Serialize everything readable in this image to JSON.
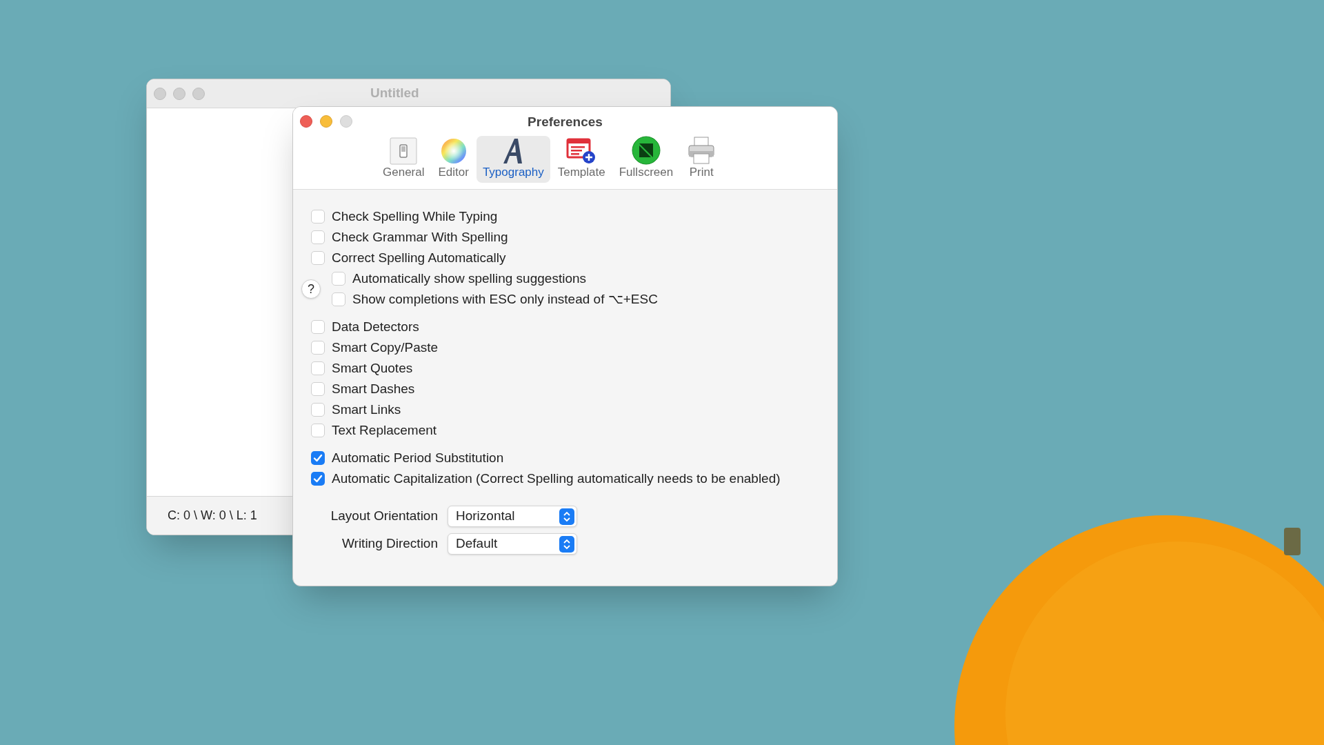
{
  "back_window": {
    "title": "Untitled",
    "status_bar": "C: 0 \\ W: 0 \\ L: 1"
  },
  "preferences": {
    "title": "Preferences",
    "tabs": [
      {
        "label": "General",
        "selected": false
      },
      {
        "label": "Editor",
        "selected": false
      },
      {
        "label": "Typography",
        "selected": true
      },
      {
        "label": "Template",
        "selected": false
      },
      {
        "label": "Fullscreen",
        "selected": false
      },
      {
        "label": "Print",
        "selected": false
      }
    ],
    "help_button": "?",
    "option_groups": [
      [
        {
          "label": "Check Spelling While Typing",
          "checked": false
        },
        {
          "label": "Check Grammar With Spelling",
          "checked": false
        },
        {
          "label": "Correct Spelling Automatically",
          "checked": false,
          "children": [
            {
              "label": "Automatically show spelling suggestions",
              "checked": false
            },
            {
              "label": "Show completions with ESC only instead of ⌥+ESC",
              "checked": false
            }
          ]
        }
      ],
      [
        {
          "label": "Data Detectors",
          "checked": false
        },
        {
          "label": "Smart Copy/Paste",
          "checked": false
        },
        {
          "label": "Smart Quotes",
          "checked": false
        },
        {
          "label": "Smart Dashes",
          "checked": false
        },
        {
          "label": "Smart Links",
          "checked": false
        },
        {
          "label": "Text Replacement",
          "checked": false
        }
      ],
      [
        {
          "label": "Automatic Period Substitution",
          "checked": true
        },
        {
          "label": "Automatic Capitalization (Correct Spelling automatically needs to be enabled)",
          "checked": true
        }
      ]
    ],
    "popups": [
      {
        "label": "Layout Orientation",
        "value": "Horizontal"
      },
      {
        "label": "Writing Direction",
        "value": "Default"
      }
    ]
  }
}
